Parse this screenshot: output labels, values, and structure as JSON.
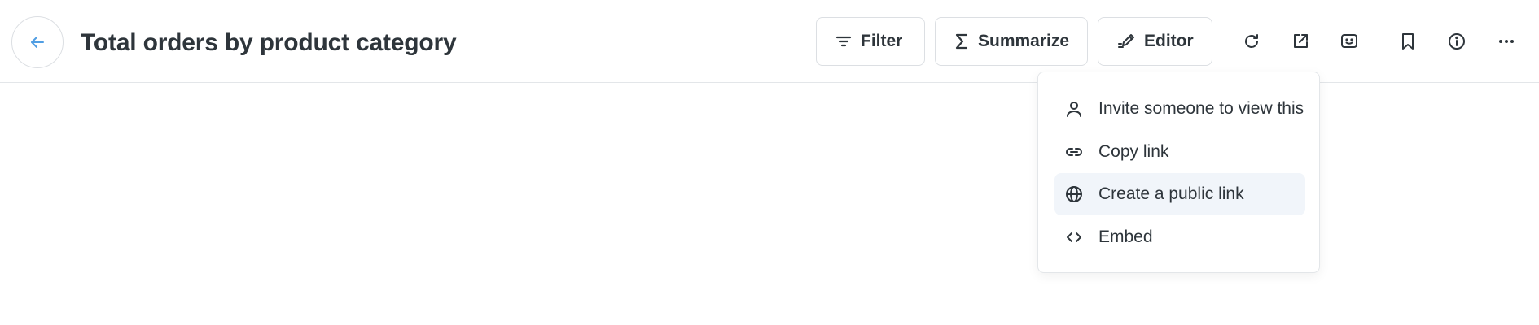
{
  "header": {
    "title": "Total orders by product category"
  },
  "toolbar": {
    "filter_label": "Filter",
    "summarize_label": "Summarize",
    "editor_label": "Editor"
  },
  "share_menu": {
    "items": [
      {
        "label": "Invite someone to view this",
        "icon": "person-icon"
      },
      {
        "label": "Copy link",
        "icon": "link-icon"
      },
      {
        "label": "Create a public link",
        "icon": "globe-icon",
        "highlighted": true
      },
      {
        "label": "Embed",
        "icon": "code-icon"
      }
    ]
  },
  "colors": {
    "accent": "#509ee3",
    "text": "#2e353b",
    "border": "#dcdfe3",
    "highlight_bg": "#f1f5fa"
  }
}
